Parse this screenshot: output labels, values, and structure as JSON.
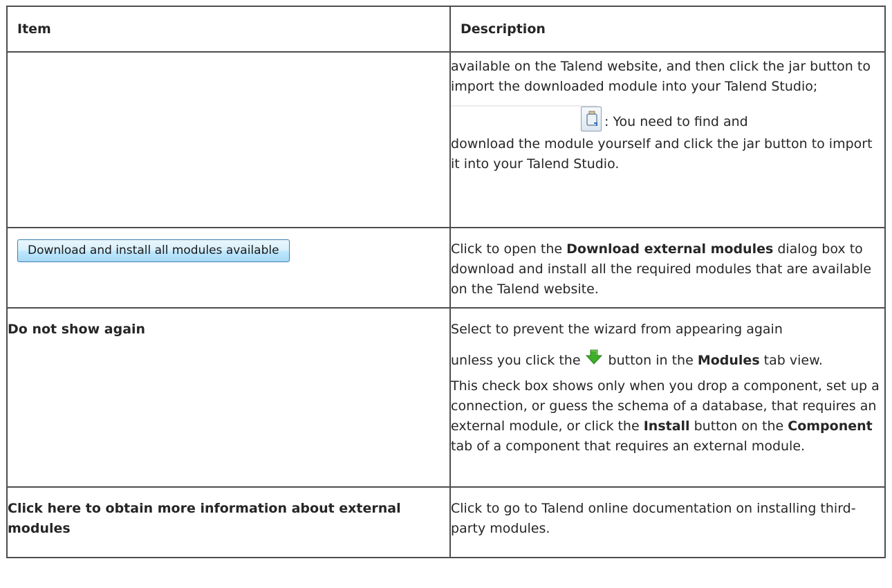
{
  "header": {
    "item": "Item",
    "description": "Description"
  },
  "row1": {
    "desc_p1": "available on the Talend website, and then click the jar button to import the downloaded module into your Talend Studio;",
    "desc_p2_lead": ": You need to find and",
    "desc_p2_rest": "download the module yourself and click the jar button to import it into your Talend Studio."
  },
  "row2": {
    "button_label": "Download and install all modules available",
    "desc_pre": "Click to open the ",
    "desc_bold": "Download external modules",
    "desc_post": " dialog box to download and install all the required modules that are available on the Talend website."
  },
  "row3": {
    "item": "Do not show again",
    "desc_p1": "Select to prevent the wizard from appearing again",
    "desc_p2_pre": "unless you click the",
    "desc_p2_mid": "button in the ",
    "desc_p2_bold": "Modules",
    "desc_p2_post": " tab view.",
    "desc_p3_a": "This check box shows only when you drop a component, set up a connection, or guess the schema of a database, that requires an external module, or click the ",
    "desc_p3_bold1": "Install",
    "desc_p3_b": " button on the ",
    "desc_p3_bold2": "Component",
    "desc_p3_c": " tab of a component that requires an external module."
  },
  "row4": {
    "item": "Click here to obtain more information about external modules",
    "desc": "Click to go to Talend online documentation on installing third-party modules."
  },
  "icons": {
    "jar": "jar-icon",
    "arrow": "green-down-arrow-icon"
  }
}
